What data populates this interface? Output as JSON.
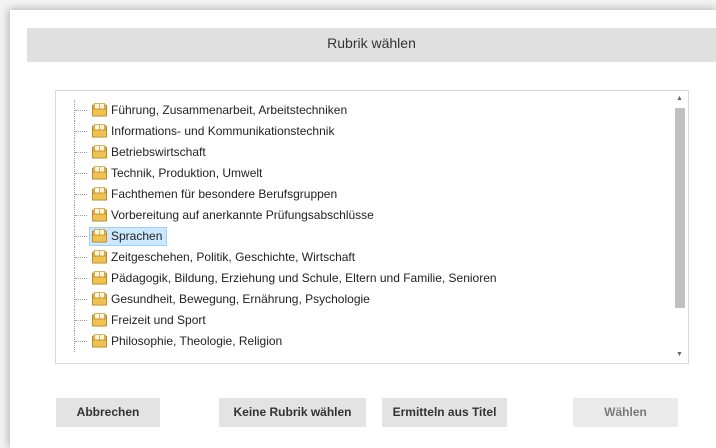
{
  "dialog": {
    "title": "Rubrik wählen"
  },
  "tree": {
    "items": [
      {
        "label": "Führung, Zusammenarbeit, Arbeitstechniken",
        "icon": "folder-book-icon"
      },
      {
        "label": "Informations- und Kommunikationstechnik",
        "icon": "folder-book-icon"
      },
      {
        "label": "Betriebswirtschaft",
        "icon": "folder-book-icon"
      },
      {
        "label": "Technik, Produktion, Umwelt",
        "icon": "folder-book-icon"
      },
      {
        "label": "Fachthemen für besondere Berufsgruppen",
        "icon": "folder-book-icon"
      },
      {
        "label": "Vorbereitung auf anerkannte Prüfungsabschlüsse",
        "icon": "folder-book-icon"
      },
      {
        "label": "Sprachen",
        "icon": "folder-book-icon",
        "selected": true
      },
      {
        "label": "Zeitgeschehen, Politik, Geschichte, Wirtschaft",
        "icon": "folder-book-icon"
      },
      {
        "label": "Pädagogik, Bildung, Erziehung und Schule, Eltern und Familie, Senioren",
        "icon": "folder-book-icon"
      },
      {
        "label": "Gesundheit, Bewegung, Ernährung, Psychologie",
        "icon": "folder-book-icon"
      },
      {
        "label": "Freizeit und Sport",
        "icon": "folder-book-icon"
      },
      {
        "label": "Philosophie, Theologie, Religion",
        "icon": "folder-book-icon"
      }
    ],
    "selected_color": "#cce8ff"
  },
  "buttons": {
    "cancel": "Abbrechen",
    "no_category": "Keine Rubrik wählen",
    "from_title": "Ermitteln aus Titel",
    "choose": "Wählen"
  }
}
